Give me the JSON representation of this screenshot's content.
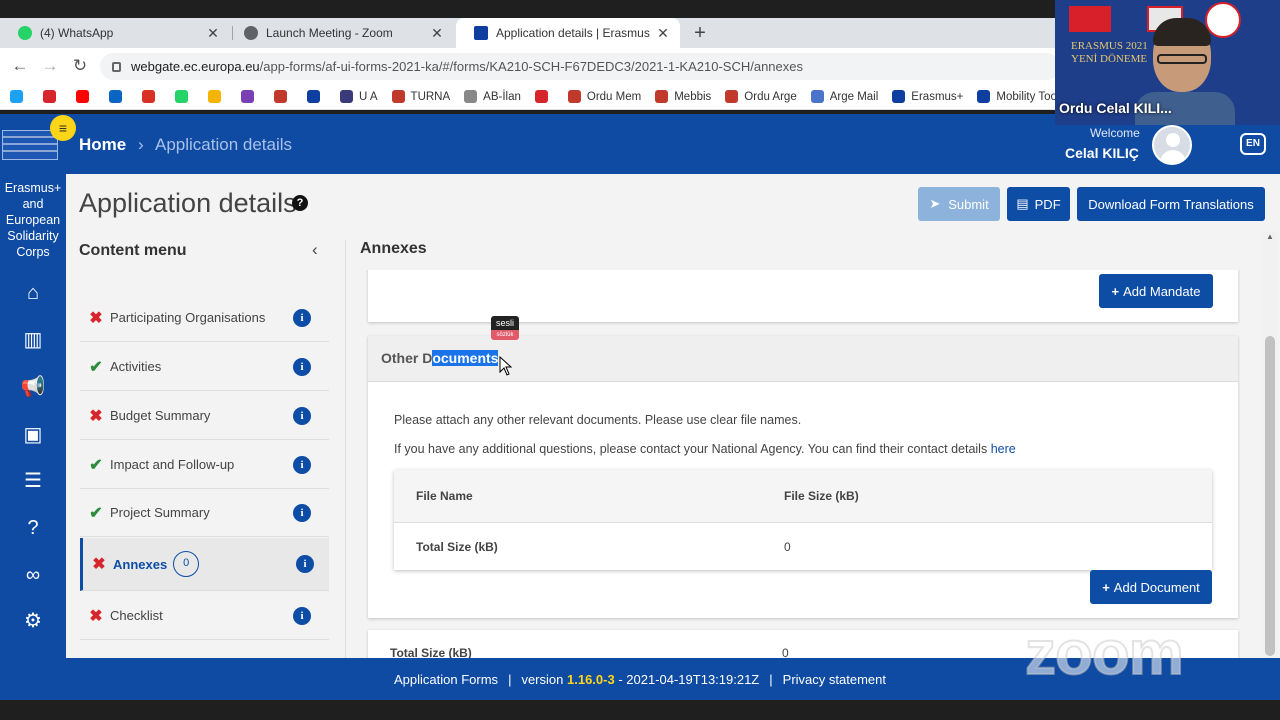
{
  "browser": {
    "tabs": [
      {
        "title": "(4) WhatsApp",
        "icon": "whatsapp-icon",
        "color": "#25d366"
      },
      {
        "title": "Launch Meeting - Zoom",
        "icon": "globe-icon",
        "color": "#5f6368"
      },
      {
        "title": "Application details | Erasmus+ ar",
        "icon": "eu-flag-icon",
        "color": "#0e3fa0"
      }
    ],
    "url_host": "webgate.ec.europa.eu",
    "url_path": "/app-forms/af-ui-forms-2021-ka/#/forms/KA210-SCH-F67DEDC3/2021-1-KA210-SCH/annexes",
    "bookmarks": [
      {
        "label": "",
        "icon": "twitter-icon",
        "color": "#1da1f2"
      },
      {
        "label": "",
        "icon": "app-icon",
        "color": "#d6252b"
      },
      {
        "label": "",
        "icon": "youtube-icon",
        "color": "#ff0000"
      },
      {
        "label": "",
        "icon": "outlook-icon",
        "color": "#0a64c2"
      },
      {
        "label": "",
        "icon": "gmail-icon",
        "color": "#d93025"
      },
      {
        "label": "",
        "icon": "whatsapp-icon",
        "color": "#25d366"
      },
      {
        "label": "",
        "icon": "drive-icon",
        "color": "#f4b400"
      },
      {
        "label": "",
        "icon": "en-icon",
        "color": "#7b3fb5"
      },
      {
        "label": "",
        "icon": "bookmark-icon",
        "color": "#c0392b"
      },
      {
        "label": "",
        "icon": "bookmark-icon",
        "color": "#0e3fa0"
      },
      {
        "label": "U A",
        "icon": "ua-icon",
        "color": "#3a3a7a"
      },
      {
        "label": "TURNA",
        "icon": "turna-icon",
        "color": "#c0392b"
      },
      {
        "label": "AB-İlan",
        "icon": "ab-icon",
        "color": "#888888"
      },
      {
        "label": "",
        "icon": "elx-icon",
        "color": "#d6252b",
        "text": "elx"
      },
      {
        "label": "Ordu Mem",
        "icon": "seal-icon",
        "color": "#c0392b"
      },
      {
        "label": "Mebbis",
        "icon": "seal-icon",
        "color": "#c0392b"
      },
      {
        "label": "Ordu Arge",
        "icon": "seal-icon",
        "color": "#c0392b"
      },
      {
        "label": "Arge Mail",
        "icon": "mail-icon",
        "color": "#4a74c9"
      },
      {
        "label": "Erasmus+",
        "icon": "eu-flag-icon",
        "color": "#0e3fa0"
      },
      {
        "label": "Mobility Too",
        "icon": "eu-flag-icon",
        "color": "#0e3fa0"
      }
    ]
  },
  "header": {
    "menu_icon": "≡",
    "home": "Home",
    "separator": "›",
    "current": "Application details",
    "welcome": "Welcome",
    "user": "Celal KILIÇ",
    "lang": "EN"
  },
  "rail": {
    "title": "Erasmus+ and European Solidarity Corps",
    "icons": [
      "home-icon",
      "institution-icon",
      "megaphone-icon",
      "document-icon",
      "list-icon",
      "help-icon",
      "link-icon",
      "settings-icon"
    ]
  },
  "page": {
    "title": "Application details",
    "help": "?",
    "buttons": {
      "submit": "Submit",
      "pdf": "PDF",
      "translations": "Download Form Translations"
    }
  },
  "content_menu": {
    "title": "Content menu",
    "collapse": "‹",
    "items": [
      {
        "label": "Participating Organisations",
        "status": "x"
      },
      {
        "label": "Activities",
        "status": "ok"
      },
      {
        "label": "Budget Summary",
        "status": "x"
      },
      {
        "label": "Impact and Follow-up",
        "status": "ok"
      },
      {
        "label": "Project Summary",
        "status": "ok"
      },
      {
        "label": "Annexes",
        "status": "x",
        "count": "0",
        "active": true
      },
      {
        "label": "Checklist",
        "status": "x"
      }
    ]
  },
  "annexes": {
    "title": "Annexes",
    "add_mandate": "Add Mandate",
    "other_docs_title_pre": "Other D",
    "other_docs_title_sel": "ocuments",
    "attach_text": "Please attach any other relevant documents. Please use clear file names.",
    "contact_text": "If you have any additional questions, please contact your National Agency. You can find their contact details ",
    "contact_link": "here",
    "table": {
      "col_name": "File Name",
      "col_size": "File Size (kB)",
      "total_label": "Total Size (kB)",
      "total_value": "0"
    },
    "add_document": "Add Document",
    "grand_total_label": "Total Size (kB)",
    "grand_total_value": "0"
  },
  "footer": {
    "app_forms": "Application Forms",
    "version_label": "version",
    "version_num": "1.16.0-3",
    "version_date": "- 2021-04-19T13:19:21Z",
    "privacy": "Privacy statement"
  },
  "overlays": {
    "sesli_top": "sesli",
    "sesli_bottom": "sözlük",
    "zoom_name": "Ordu Celal KILI...",
    "zoom_text1": "ERASMUS 2021",
    "zoom_text2": "YENİ DÖNEME",
    "zoom_watermark": "zoom"
  }
}
